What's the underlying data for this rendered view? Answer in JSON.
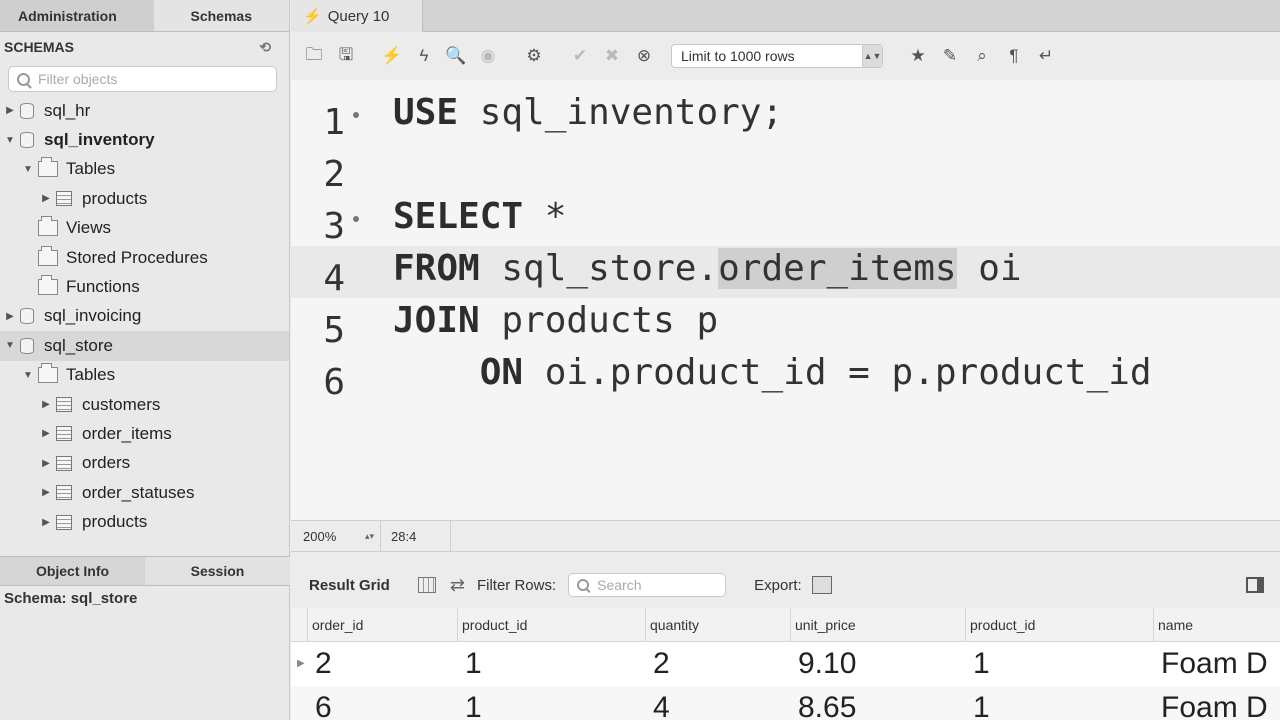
{
  "sidebar": {
    "tabs": [
      "Administration",
      "Schemas"
    ],
    "header": "SCHEMAS",
    "filter_placeholder": "Filter objects",
    "tree": [
      {
        "label": "sql_hr",
        "type": "db",
        "level": 0,
        "expanded": false,
        "bold": false,
        "selected": false
      },
      {
        "label": "sql_inventory",
        "type": "db",
        "level": 0,
        "expanded": true,
        "bold": true,
        "selected": false
      },
      {
        "label": "Tables",
        "type": "folder",
        "level": 1,
        "expanded": true
      },
      {
        "label": "products",
        "type": "table",
        "level": 2,
        "expanded": false
      },
      {
        "label": "Views",
        "type": "folder",
        "level": 1,
        "noarrow": true
      },
      {
        "label": "Stored Procedures",
        "type": "folder",
        "level": 1,
        "noarrow": true
      },
      {
        "label": "Functions",
        "type": "folder",
        "level": 1,
        "noarrow": true
      },
      {
        "label": "sql_invoicing",
        "type": "db",
        "level": 0,
        "expanded": false
      },
      {
        "label": "sql_store",
        "type": "db",
        "level": 0,
        "expanded": true,
        "selected": true
      },
      {
        "label": "Tables",
        "type": "folder",
        "level": 1,
        "expanded": true
      },
      {
        "label": "customers",
        "type": "table",
        "level": 2
      },
      {
        "label": "order_items",
        "type": "table",
        "level": 2
      },
      {
        "label": "orders",
        "type": "table",
        "level": 2
      },
      {
        "label": "order_statuses",
        "type": "table",
        "level": 2
      },
      {
        "label": "products",
        "type": "table",
        "level": 2
      }
    ],
    "info_tabs": [
      "Object Info",
      "Session"
    ],
    "schema_info": "Schema: sql_store"
  },
  "query_tab": {
    "label": "Query 10"
  },
  "toolbar": {
    "limit_label": "Limit to 1000 rows"
  },
  "editor": {
    "lines": [
      {
        "num": "1",
        "kw": "USE",
        "rest": " sql_inventory;",
        "dot": true
      },
      {
        "num": "2",
        "kw": "",
        "rest": "",
        "dot": false
      },
      {
        "num": "3",
        "kw": "SELECT",
        "rest": " *",
        "dot": true
      },
      {
        "num": "4",
        "kw": "FROM",
        "rest": " sql_store.",
        "sel": "order_items",
        "after": " oi",
        "dot": false
      },
      {
        "num": "5",
        "kw": "JOIN",
        "rest": " products p",
        "dot": false
      },
      {
        "num": "6",
        "indent": "    ",
        "kw": "ON",
        "rest": " oi.product_id = p.product_id",
        "dot": false
      }
    ]
  },
  "status": {
    "zoom": "200%",
    "position": "28:4"
  },
  "results": {
    "title": "Result Grid",
    "filter_label": "Filter Rows:",
    "search_placeholder": "Search",
    "export_label": "Export:",
    "columns": [
      "order_id",
      "product_id",
      "quantity",
      "unit_price",
      "product_id",
      "name"
    ],
    "rows": [
      [
        "2",
        "1",
        "2",
        "9.10",
        "1",
        "Foam D"
      ],
      [
        "6",
        "1",
        "4",
        "8.65",
        "1",
        "Foam D"
      ]
    ]
  }
}
